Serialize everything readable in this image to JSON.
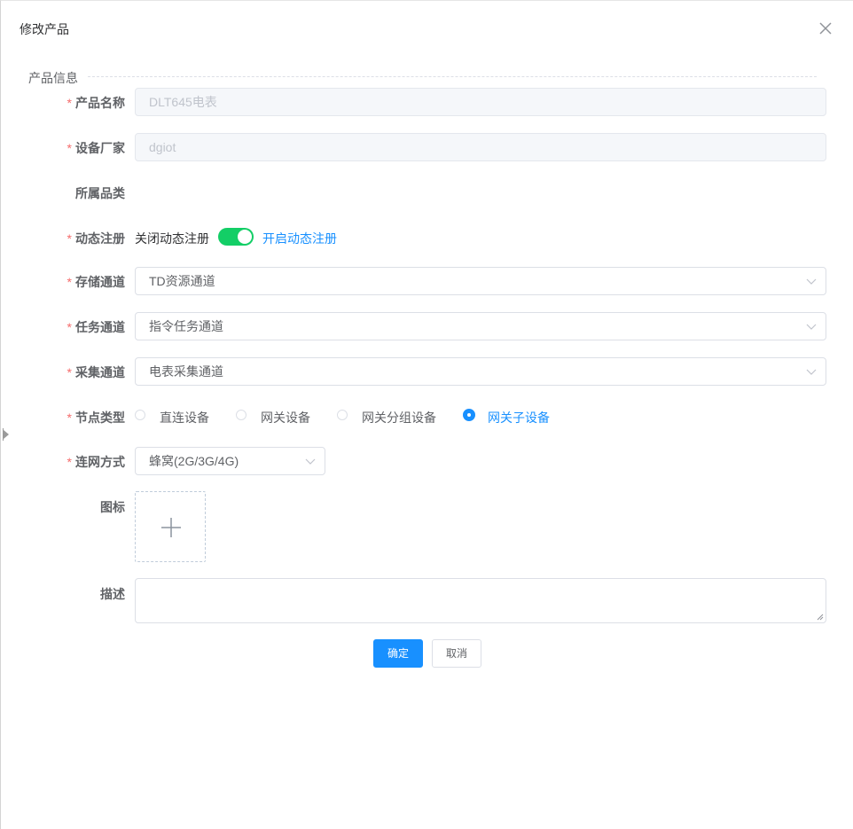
{
  "dialog": {
    "title": "修改产品"
  },
  "section": {
    "label": "产品信息"
  },
  "form": {
    "product_name": {
      "label": "产品名称",
      "value": "DLT645电表"
    },
    "vendor": {
      "label": "设备厂家",
      "value": "dgiot"
    },
    "category": {
      "label": "所属品类"
    },
    "dynamic_register": {
      "label": "动态注册",
      "off_text": "关闭动态注册",
      "on_text": "开启动态注册",
      "enabled": true
    },
    "storage_channel": {
      "label": "存储通道",
      "value": "TD资源通道"
    },
    "task_channel": {
      "label": "任务通道",
      "value": "指令任务通道"
    },
    "collect_channel": {
      "label": "采集通道",
      "value": "电表采集通道"
    },
    "node_type": {
      "label": "节点类型",
      "options": [
        "直连设备",
        "网关设备",
        "网关分组设备",
        "网关子设备"
      ],
      "selected": "网关子设备"
    },
    "network": {
      "label": "连网方式",
      "value": "蜂窝(2G/3G/4G)"
    },
    "icon": {
      "label": "图标"
    },
    "description": {
      "label": "描述",
      "value": ""
    }
  },
  "buttons": {
    "confirm": "确定",
    "cancel": "取消"
  },
  "colors": {
    "primary": "#1890ff",
    "switch_on": "#13ce66",
    "required": "#f56c6c"
  }
}
